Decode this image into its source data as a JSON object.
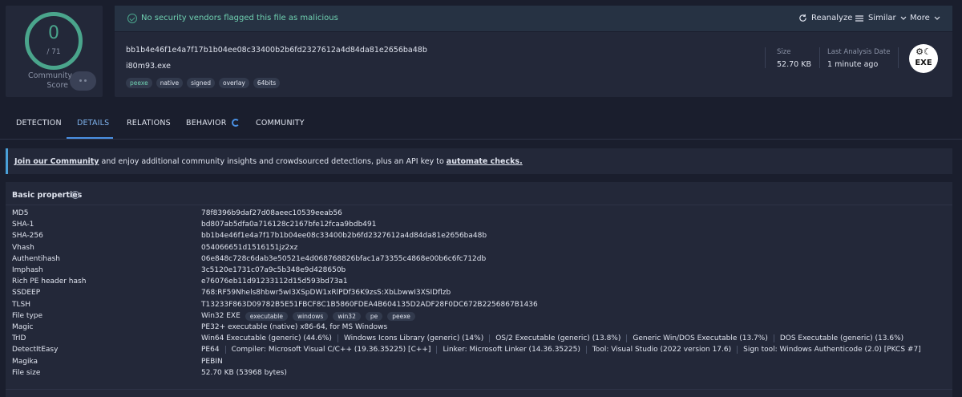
{
  "score": {
    "detections": "0",
    "total": "/ 71",
    "community_label_1": "Community",
    "community_label_2": "Score"
  },
  "banner": {
    "message": "No security vendors flagged this file as malicious",
    "reanalyze": "Reanalyze",
    "similar": "Similar",
    "more": "More"
  },
  "file": {
    "sha256": "bb1b4e46f1e4a7f17b1b04ee08c33400b2b6fd2327612a4d84da81e2656ba48b",
    "name": "i80m93.exe",
    "tags": [
      "peexe",
      "native",
      "signed",
      "overlay",
      "64bits"
    ],
    "size_label": "Size",
    "size_value": "52.70 KB",
    "date_label": "Last Analysis Date",
    "date_value": "1 minute ago",
    "type_badge": "EXE"
  },
  "tabs": [
    "DETECTION",
    "DETAILS",
    "RELATIONS",
    "BEHAVIOR",
    "COMMUNITY"
  ],
  "join": {
    "link1": "Join our Community",
    "text": " and enjoy additional community insights and crowdsourced detections, plus an API key to ",
    "link2": "automate checks."
  },
  "props": {
    "title": "Basic properties",
    "rows": [
      {
        "k": "MD5",
        "v": "78f8396b9daf27d08aeec10539eeab56"
      },
      {
        "k": "SHA-1",
        "v": "bd807ab5dfa0a716128c2167bfe12fcaa9bdb491"
      },
      {
        "k": "SHA-256",
        "v": "bb1b4e46f1e4a7f17b1b04ee08c33400b2b6fd2327612a4d84da81e2656ba48b"
      },
      {
        "k": "Vhash",
        "v": "054066651d1516151jz2xz"
      },
      {
        "k": "Authentihash",
        "v": "06e848c728c6dab3e50521e4d068768826bfac1a73355c4868e00b6c6fc712db"
      },
      {
        "k": "Imphash",
        "v": "3c5120e1731c07a9c5b348e9d428650b"
      },
      {
        "k": "Rich PE header hash",
        "v": "e76076eb11d91233112d15d593bd73a1"
      },
      {
        "k": "SSDEEP",
        "v": "768:RF59Nhels8hbwr5wI3XSpDW1xRlPDf36K9zsS:XbLbwwI3XSIDflzb"
      },
      {
        "k": "TLSH",
        "v": "T13233F863D09782B5E51FBCF8C1B5860FDEA4B604135D2ADF28F0DC672B2256867B1436"
      },
      {
        "k": "File type",
        "v": "Win32 EXE",
        "chips": [
          "executable",
          "windows",
          "win32",
          "pe",
          "peexe"
        ]
      },
      {
        "k": "Magic",
        "v": "PE32+ executable (native) x86-64, for MS Windows"
      },
      {
        "k": "TrID",
        "segs": [
          "Win64 Executable (generic) (44.6%)",
          "Windows Icons Library (generic) (14%)",
          "OS/2 Executable (generic) (13.8%)",
          "Generic Win/DOS Executable (13.7%)",
          "DOS Executable (generic) (13.6%)"
        ]
      },
      {
        "k": "DetectItEasy",
        "segs": [
          "PE64",
          "Compiler: Microsoft Visual C/C++ (19.36.35225) [C++]",
          "Linker: Microsoft Linker (14.36.35225)",
          "Tool: Visual Studio (2022 version 17.6)",
          "Sign tool: Windows Authenticode (2.0) [PKCS #7]"
        ]
      },
      {
        "k": "Magika",
        "v": "PEBIN"
      },
      {
        "k": "File size",
        "v": "52.70 KB (53968 bytes)"
      }
    ]
  }
}
